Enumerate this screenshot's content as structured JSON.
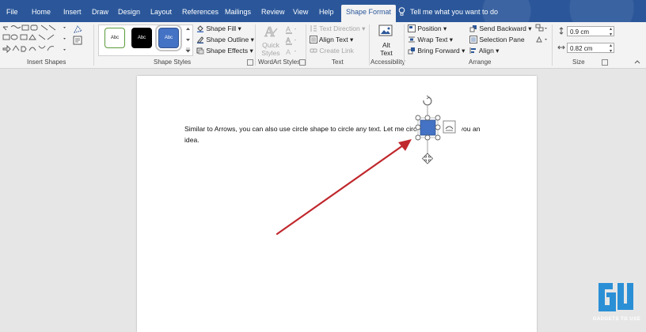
{
  "tabs": [
    {
      "label": "File",
      "active": false
    },
    {
      "label": "Home",
      "active": false
    },
    {
      "label": "Insert",
      "active": false
    },
    {
      "label": "Draw",
      "active": false
    },
    {
      "label": "Design",
      "active": false
    },
    {
      "label": "Layout",
      "active": false
    },
    {
      "label": "References",
      "active": false
    },
    {
      "label": "Mailings",
      "active": false
    },
    {
      "label": "Review",
      "active": false
    },
    {
      "label": "View",
      "active": false
    },
    {
      "label": "Help",
      "active": false
    },
    {
      "label": "Shape Format",
      "active": true
    }
  ],
  "tell_me": "Tell me what you want to do",
  "ribbon": {
    "insert_shapes": {
      "label": "Insert Shapes"
    },
    "shape_styles": {
      "label": "Shape Styles",
      "presets": [
        "Abc",
        "Abc",
        "Abc"
      ],
      "fill": "Shape Fill",
      "outline": "Shape Outline",
      "effects": "Shape Effects"
    },
    "wordart": {
      "label": "WordArt Styles",
      "quick_styles_1": "Quick",
      "quick_styles_2": "Styles"
    },
    "text": {
      "label": "Text",
      "direction": "Text Direction",
      "align": "Align Text",
      "link": "Create Link"
    },
    "accessibility": {
      "label": "Accessibility",
      "alt_1": "Alt",
      "alt_2": "Text"
    },
    "arrange": {
      "label": "Arrange",
      "position": "Position",
      "wrap": "Wrap Text",
      "bring_forward": "Bring Forward",
      "send_backward": "Send Backward",
      "selection_pane": "Selection Pane",
      "align": "Align"
    },
    "size": {
      "label": "Size",
      "height": "0.9 cm",
      "width": "0.82 cm"
    }
  },
  "document": {
    "line1": "Similar to Arrows, you can also use circle shape to circle any text. Let me circle",
    "line1_tail": "you an",
    "line2": "idea."
  },
  "colors": {
    "accent": "#2b579a",
    "shape": "#4472c4",
    "arrow": "#c0282d"
  },
  "watermark": {
    "text": "GADGETS TO USE"
  }
}
